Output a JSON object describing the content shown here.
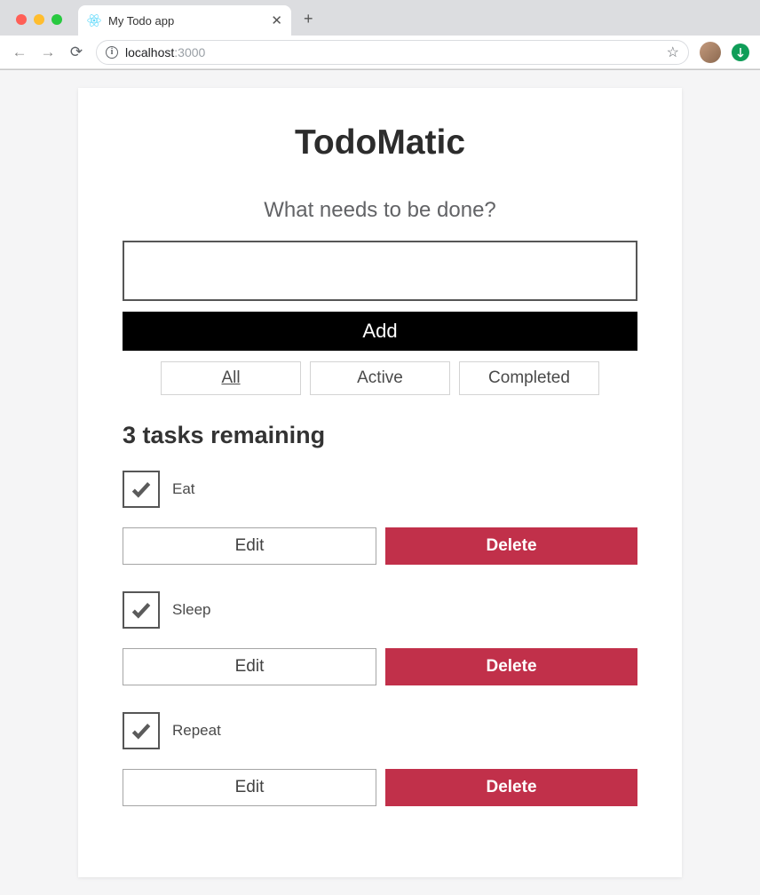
{
  "browser": {
    "tab_title": "My Todo app",
    "url_host": "localhost",
    "url_path": ":3000"
  },
  "app": {
    "title": "TodoMatic",
    "prompt": "What needs to be done?",
    "add_label": "Add",
    "new_todo_value": ""
  },
  "filters": {
    "all": "All",
    "active": "Active",
    "completed": "Completed",
    "selected": "all"
  },
  "status": {
    "remaining": "3 tasks remaining"
  },
  "buttons": {
    "edit": "Edit",
    "delete": "Delete"
  },
  "tasks": [
    {
      "label": "Eat",
      "checked": true
    },
    {
      "label": "Sleep",
      "checked": true
    },
    {
      "label": "Repeat",
      "checked": true
    }
  ]
}
